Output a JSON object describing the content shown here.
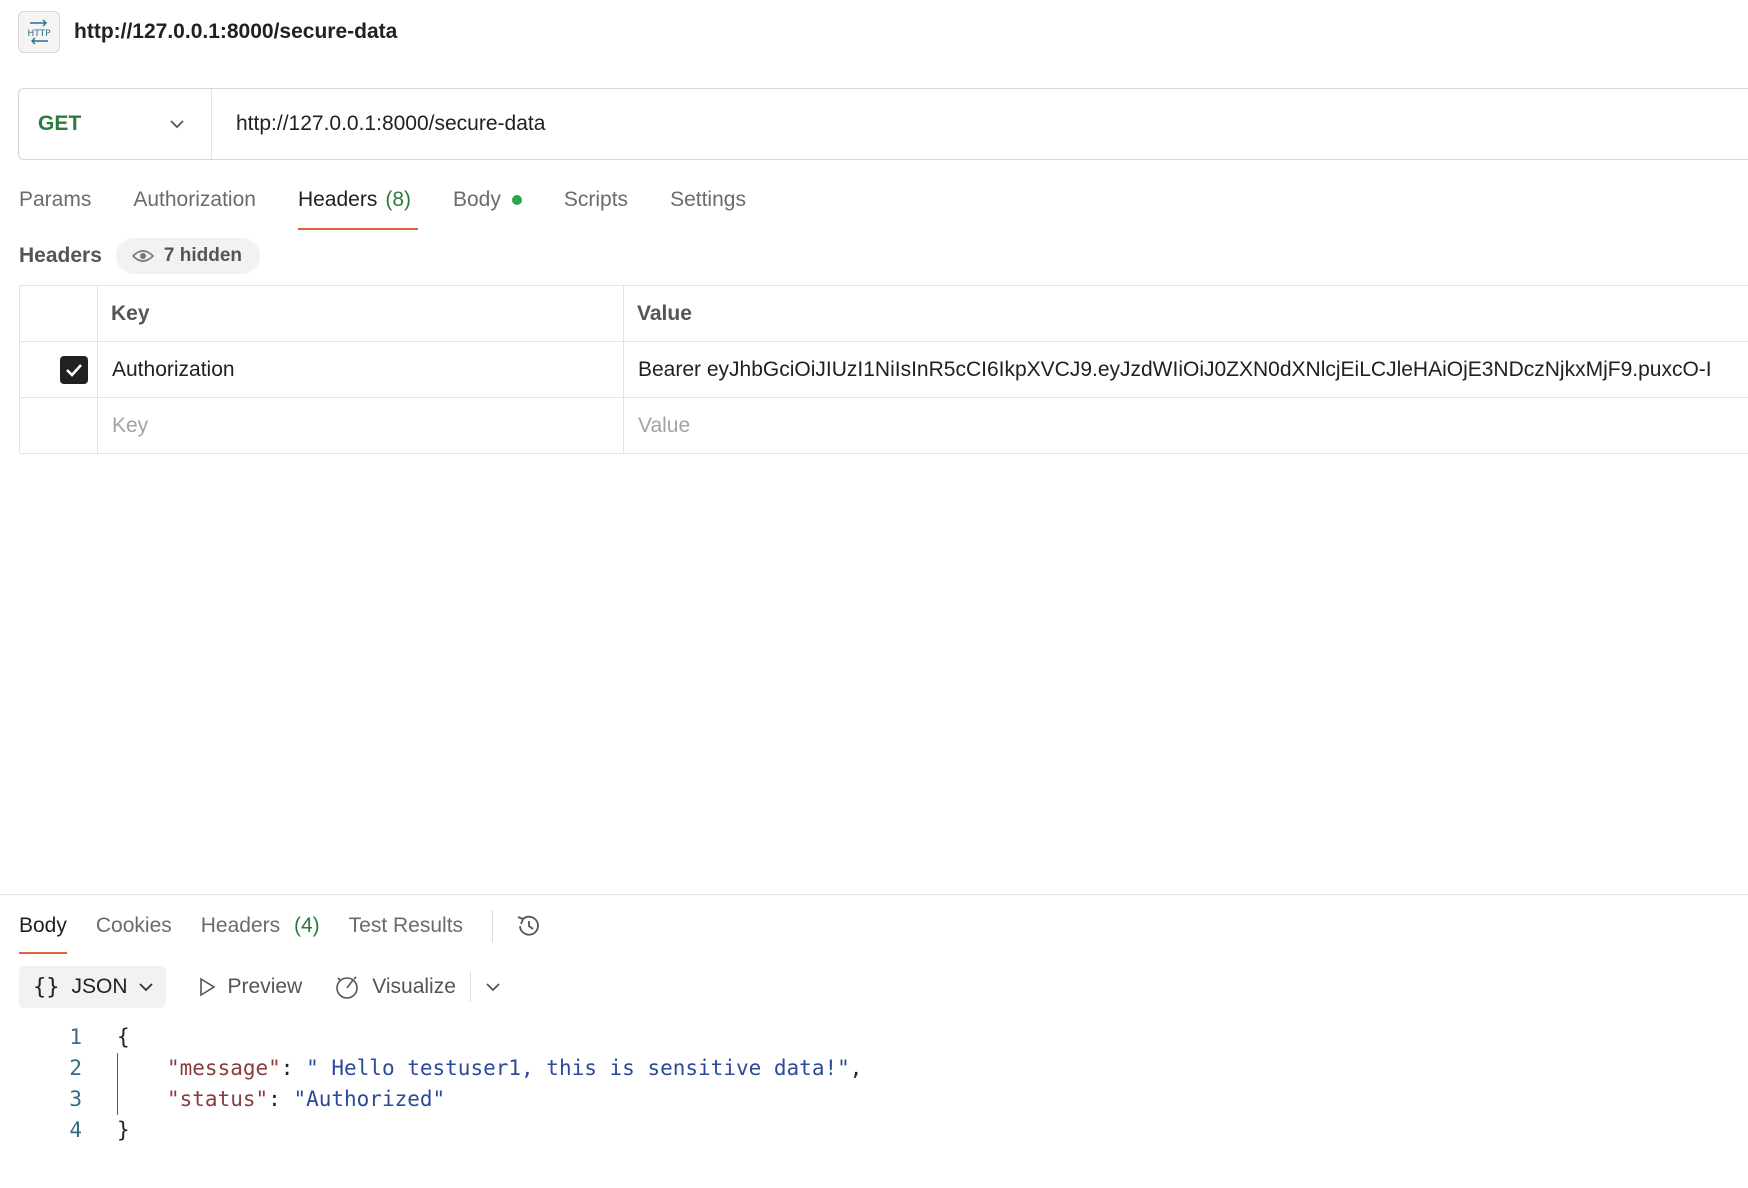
{
  "title_bar": {
    "icon_label": "HTTP",
    "title": "http://127.0.0.1:8000/secure-data"
  },
  "request": {
    "method": "GET",
    "url": "http://127.0.0.1:8000/secure-data"
  },
  "request_tabs": [
    {
      "label": "Params"
    },
    {
      "label": "Authorization"
    },
    {
      "label": "Headers",
      "count": "(8)"
    },
    {
      "label": "Body"
    },
    {
      "label": "Scripts"
    },
    {
      "label": "Settings"
    }
  ],
  "headers": {
    "section_label": "Headers",
    "hidden_label": "7 hidden",
    "columns": {
      "key": "Key",
      "value": "Value"
    },
    "rows": [
      {
        "key": "Authorization",
        "value": "Bearer eyJhbGciOiJIUzI1NiIsInR5cCI6IkpXVCJ9.eyJzdWIiOiJ0ZXN0dXNlcjEiLCJleHAiOjE3NDczNjkxMjF9.puxcO-I",
        "checked": true
      }
    ],
    "placeholders": {
      "key": "Key",
      "value": "Value"
    }
  },
  "response_tabs": [
    {
      "label": "Body"
    },
    {
      "label": "Cookies"
    },
    {
      "label": "Headers",
      "count": "(4)"
    },
    {
      "label": "Test Results"
    }
  ],
  "response_toolbar": {
    "format": "JSON",
    "preview": "Preview",
    "visualize": "Visualize"
  },
  "response_body": {
    "line_numbers": [
      "1",
      "2",
      "3",
      "4"
    ],
    "open_brace": "{",
    "close_brace": "}",
    "message_key": "\"message\"",
    "message_value": "\" Hello testuser1, this is sensitive data!\"",
    "status_key": "\"status\"",
    "status_value": "\"Authorized\"",
    "colon": ": ",
    "comma": ","
  },
  "colors": {
    "accent": "#e0633b",
    "method_green": "#2d7a3e",
    "body_dot": "#2ea44f"
  },
  "icons": [
    "http-icon",
    "chevron-down-icon",
    "eye-icon",
    "check-icon",
    "history-icon",
    "play-icon",
    "visualize-icon"
  ]
}
